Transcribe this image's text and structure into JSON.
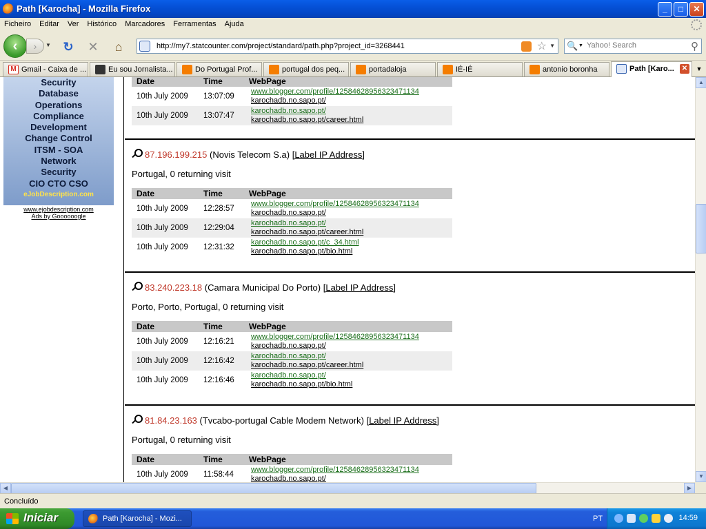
{
  "window": {
    "title": "Path [Karocha] - Mozilla Firefox",
    "controls": {
      "minimize": "_",
      "maximize": "□",
      "close": "✕"
    }
  },
  "menu": [
    "Ficheiro",
    "Editar",
    "Ver",
    "Histórico",
    "Marcadores",
    "Ferramentas",
    "Ajuda"
  ],
  "nav": {
    "url": "http://my7.statcounter.com/project/standard/path.php?project_id=3268441",
    "search_placeholder": "Yahoo! Search"
  },
  "tabs": [
    {
      "label": "Gmail - Caixa de ...",
      "icon": "gmail-icon",
      "color": "#d93025"
    },
    {
      "label": "Eu sou Jornalista...",
      "icon": "newspaper-icon",
      "color": "#333333"
    },
    {
      "label": "Do Portugal Prof...",
      "icon": "blogger-icon",
      "color": "#f57d00"
    },
    {
      "label": "portugal dos peq...",
      "icon": "blogger-icon",
      "color": "#f57d00"
    },
    {
      "label": "portadaloja",
      "icon": "blogger-icon",
      "color": "#f57d00"
    },
    {
      "label": "IÉ-IÉ",
      "icon": "blogger-icon",
      "color": "#f57d00"
    },
    {
      "label": "antonio boronha",
      "icon": "blogger-icon",
      "color": "#f57d00"
    },
    {
      "label": "Path [Karo...",
      "icon": "statcounter-icon",
      "color": "#3a66b0",
      "active": true
    }
  ],
  "sidebar": {
    "ad_lines": [
      "Security",
      "Database",
      "Operations",
      "Compliance",
      "Development",
      "Change Control",
      "ITSM - SOA",
      "Network",
      "Security",
      "CIO  CTO  CSO"
    ],
    "ad_brand": "eJobDescription.com",
    "ad_url": "www.ejobdescription.com",
    "ads_by": "Ads by Goooooogle"
  },
  "table_headers": {
    "date": "Date",
    "time": "Time",
    "page": "WebPage"
  },
  "label_link": "[Label IP Address]",
  "top_fragment": {
    "rows": [
      {
        "date": "10th July 2009",
        "time": "13:07:09",
        "ref": "www.blogger.com/profile/12584628956323471134",
        "page": "karochadb.no.sapo.pt/"
      },
      {
        "date": "10th July 2009",
        "time": "13:07:47",
        "ref": "karochadb.no.sapo.pt/",
        "page": "karochadb.no.sapo.pt/career.html"
      }
    ]
  },
  "visitors": [
    {
      "ip": "87.196.199.215",
      "isp": "(Novis Telecom S.a)",
      "location": "Portugal, 0 returning visit",
      "rows": [
        {
          "date": "10th July 2009",
          "time": "12:28:57",
          "ref": "www.blogger.com/profile/12584628956323471134",
          "page": "karochadb.no.sapo.pt/"
        },
        {
          "date": "10th July 2009",
          "time": "12:29:04",
          "ref": "karochadb.no.sapo.pt/",
          "page": "karochadb.no.sapo.pt/career.html"
        },
        {
          "date": "10th July 2009",
          "time": "12:31:32",
          "ref": "karochadb.no.sapo.pt/c_34.html",
          "page": "karochadb.no.sapo.pt/bio.html"
        }
      ]
    },
    {
      "ip": "83.240.223.18",
      "isp": "(Camara Municipal Do Porto)",
      "location": "Porto, Porto, Portugal, 0 returning visit",
      "rows": [
        {
          "date": "10th July 2009",
          "time": "12:16:21",
          "ref": "www.blogger.com/profile/12584628956323471134",
          "page": "karochadb.no.sapo.pt/"
        },
        {
          "date": "10th July 2009",
          "time": "12:16:42",
          "ref": "karochadb.no.sapo.pt/",
          "page": "karochadb.no.sapo.pt/career.html"
        },
        {
          "date": "10th July 2009",
          "time": "12:16:46",
          "ref": "karochadb.no.sapo.pt/",
          "page": "karochadb.no.sapo.pt/bio.html"
        }
      ]
    },
    {
      "ip": "81.84.23.163",
      "isp": "(Tvcabo-portugal Cable Modem Network)",
      "location": "Portugal, 0 returning visit",
      "rows": [
        {
          "date": "10th July 2009",
          "time": "11:58:44",
          "ref": "www.blogger.com/profile/12584628956323471134",
          "page": "karochadb.no.sapo.pt/"
        }
      ]
    }
  ],
  "status": "Concluído",
  "taskbar": {
    "start": "Iniciar",
    "item": "Path [Karocha] - Mozi...",
    "lang": "PT",
    "clock": "14:59"
  }
}
